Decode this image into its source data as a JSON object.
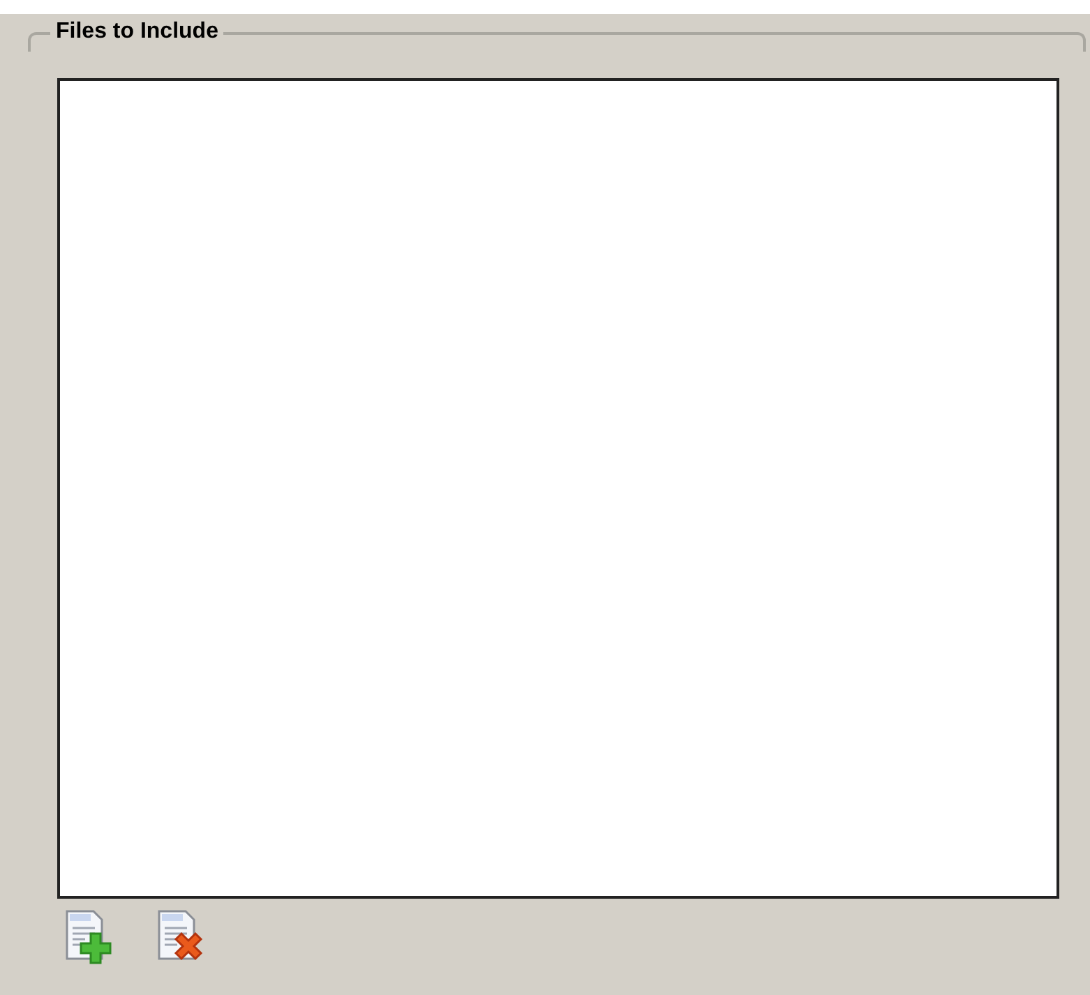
{
  "group": {
    "title": "Files to Include"
  },
  "toolbar": {
    "buttons": [
      {
        "kind": "add"
      },
      {
        "kind": "remove"
      }
    ]
  }
}
